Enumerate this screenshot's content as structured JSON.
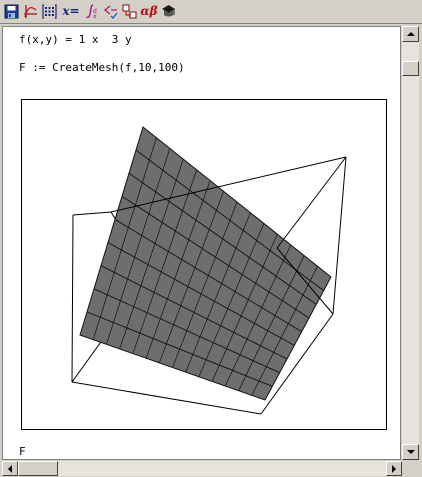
{
  "toolbar": {
    "items": [
      {
        "name": "save-icon"
      },
      {
        "name": "graph-icon"
      },
      {
        "name": "matrix-icon"
      },
      {
        "name": "evaluation-label",
        "label": "x="
      },
      {
        "name": "calculus-integral-icon"
      },
      {
        "name": "boolean-icon"
      },
      {
        "name": "programming-icon"
      },
      {
        "name": "greek-label",
        "label": "αβ"
      },
      {
        "name": "symbolic-keyword-icon"
      }
    ]
  },
  "worksheet": {
    "lines": [
      "f(x,y) = 1 x  3 y",
      "F := CreateMesh(f,10,100)",
      "F"
    ]
  },
  "plot": {
    "type": "3d-surface",
    "box_color": "#000000",
    "surface_color": "#6e6e6e",
    "mesh_color": "#111111"
  },
  "scrollbars": {
    "vertical_position": 0.05,
    "horizontal_position": 0.0
  }
}
